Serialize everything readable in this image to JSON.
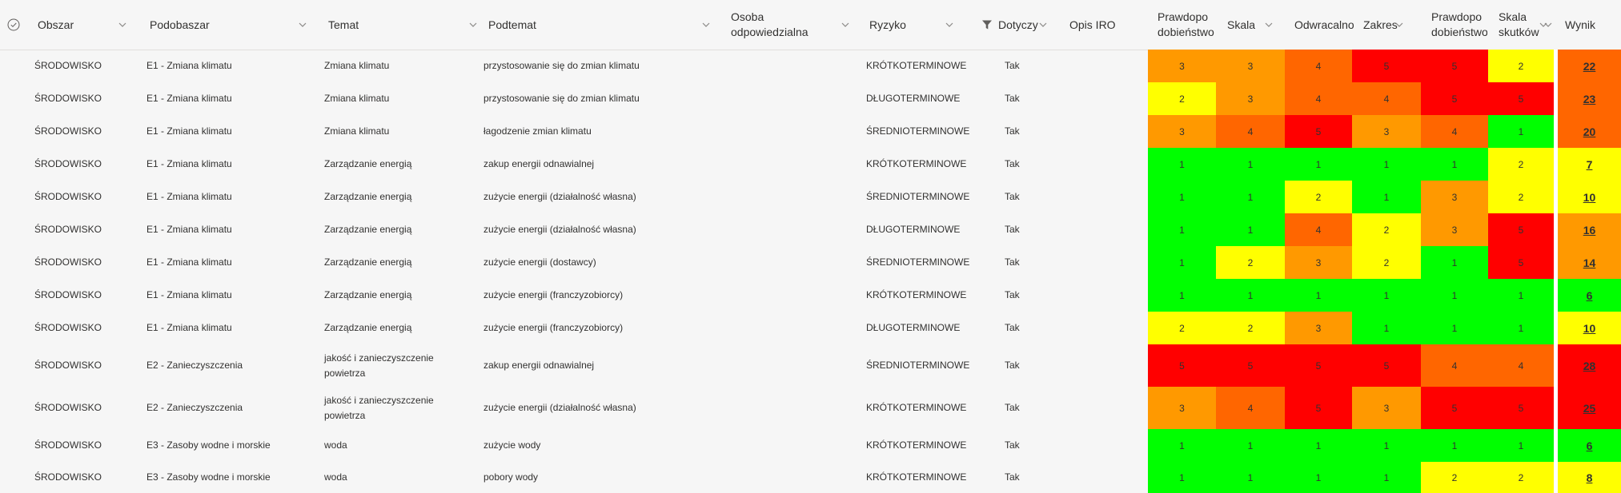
{
  "header": {
    "select_all_label": "",
    "columns": [
      {
        "key": "obszar",
        "label": "Obszar"
      },
      {
        "key": "podobszar",
        "label": "Podobaszar"
      },
      {
        "key": "temat",
        "label": "Temat"
      },
      {
        "key": "podtemat",
        "label": "Podtemat"
      },
      {
        "key": "osoba",
        "label": "Osoba odpowiedzialna"
      },
      {
        "key": "ryzyko",
        "label": "Ryzyko"
      },
      {
        "key": "dotyczy",
        "label": "Dotyczy"
      },
      {
        "key": "opis",
        "label": "Opis IRO"
      },
      {
        "key": "prawdopodobienstwo",
        "label": "Prawdopo dobieństwo"
      },
      {
        "key": "skala",
        "label": "Skala"
      },
      {
        "key": "odwracalnosc",
        "label": "Odwracalnoś"
      },
      {
        "key": "zakres",
        "label": "Zakres"
      },
      {
        "key": "prawdopodobienstwo2",
        "label": "Prawdopo dobieństwo"
      },
      {
        "key": "skala_skutkow",
        "label": "Skala skutków"
      },
      {
        "key": "wynik",
        "label": "Wynik"
      }
    ],
    "filter_icon": "filter-icon",
    "chevron_icon": "chevron-down-icon"
  },
  "colors": {
    "1": "#00ff00",
    "2": "#ffff00",
    "3": "#ff9900",
    "4": "#ff6600",
    "5": "#ff0000"
  },
  "rows": [
    {
      "obszar": "ŚRODOWISKO",
      "podobszar": "E1 - Zmiana klimatu",
      "temat": "Zmiana klimatu",
      "podtemat": "przystosowanie się do zmian klimatu",
      "osoba": "",
      "ryzyko": "KRÓTKOTERMINOWE",
      "dotyczy": "Tak",
      "opis": "",
      "scores": [
        3,
        3,
        4,
        5,
        5,
        2
      ],
      "wynik": 22,
      "wynik_level": 4
    },
    {
      "obszar": "ŚRODOWISKO",
      "podobszar": "E1 - Zmiana klimatu",
      "temat": "Zmiana klimatu",
      "podtemat": "przystosowanie się do zmian klimatu",
      "osoba": "",
      "ryzyko": "DŁUGOTERMINOWE",
      "dotyczy": "Tak",
      "opis": "",
      "scores": [
        2,
        3,
        4,
        4,
        5,
        5
      ],
      "wynik": 23,
      "wynik_level": 4
    },
    {
      "obszar": "ŚRODOWISKO",
      "podobszar": "E1 - Zmiana klimatu",
      "temat": "Zmiana klimatu",
      "podtemat": "łagodzenie zmian klimatu",
      "osoba": "",
      "ryzyko": "ŚREDNIOTERMINOWE",
      "dotyczy": "Tak",
      "opis": "",
      "scores": [
        3,
        4,
        5,
        3,
        4,
        1
      ],
      "wynik": 20,
      "wynik_level": 4
    },
    {
      "obszar": "ŚRODOWISKO",
      "podobszar": "E1 - Zmiana klimatu",
      "temat": "Zarządzanie energią",
      "podtemat": "zakup energii odnawialnej",
      "osoba": "",
      "ryzyko": "KRÓTKOTERMINOWE",
      "dotyczy": "Tak",
      "opis": "",
      "scores": [
        1,
        1,
        1,
        1,
        1,
        2
      ],
      "wynik": 7,
      "wynik_level": 2
    },
    {
      "obszar": "ŚRODOWISKO",
      "podobszar": "E1 - Zmiana klimatu",
      "temat": "Zarządzanie energią",
      "podtemat": "zużycie energii (działalność własna)",
      "osoba": "",
      "ryzyko": "ŚREDNIOTERMINOWE",
      "dotyczy": "Tak",
      "opis": "",
      "scores": [
        1,
        1,
        2,
        1,
        3,
        2
      ],
      "wynik": 10,
      "wynik_level": 2
    },
    {
      "obszar": "ŚRODOWISKO",
      "podobszar": "E1 - Zmiana klimatu",
      "temat": "Zarządzanie energią",
      "podtemat": "zużycie energii (działalność własna)",
      "osoba": "",
      "ryzyko": "DŁUGOTERMINOWE",
      "dotyczy": "Tak",
      "opis": "",
      "scores": [
        1,
        1,
        4,
        2,
        3,
        5
      ],
      "wynik": 16,
      "wynik_level": 3
    },
    {
      "obszar": "ŚRODOWISKO",
      "podobszar": "E1 - Zmiana klimatu",
      "temat": "Zarządzanie energią",
      "podtemat": "zużycie energii (dostawcy)",
      "osoba": "",
      "ryzyko": "ŚREDNIOTERMINOWE",
      "dotyczy": "Tak",
      "opis": "",
      "scores": [
        1,
        2,
        3,
        2,
        1,
        5
      ],
      "wynik": 14,
      "wynik_level": 3
    },
    {
      "obszar": "ŚRODOWISKO",
      "podobszar": "E1 - Zmiana klimatu",
      "temat": "Zarządzanie energią",
      "podtemat": "zużycie energii (franczyzobiorcy)",
      "osoba": "",
      "ryzyko": "KRÓTKOTERMINOWE",
      "dotyczy": "Tak",
      "opis": "",
      "scores": [
        1,
        1,
        1,
        1,
        1,
        1
      ],
      "wynik": 6,
      "wynik_level": 1
    },
    {
      "obszar": "ŚRODOWISKO",
      "podobszar": "E1 - Zmiana klimatu",
      "temat": "Zarządzanie energią",
      "podtemat": "zużycie energii (franczyzobiorcy)",
      "osoba": "",
      "ryzyko": "DŁUGOTERMINOWE",
      "dotyczy": "Tak",
      "opis": "",
      "scores": [
        2,
        2,
        3,
        1,
        1,
        1
      ],
      "wynik": 10,
      "wynik_level": 2
    },
    {
      "obszar": "ŚRODOWISKO",
      "podobszar": "E2 - Zanieczyszczenia",
      "temat": "jakość i zanieczyszczenie powietrza",
      "podtemat": "zakup energii odnawialnej",
      "osoba": "",
      "ryzyko": "ŚREDNIOTERMINOWE",
      "dotyczy": "Tak",
      "opis": "",
      "scores": [
        5,
        5,
        5,
        5,
        4,
        4
      ],
      "wynik": 28,
      "wynik_level": 5
    },
    {
      "obszar": "ŚRODOWISKO",
      "podobszar": "E2 - Zanieczyszczenia",
      "temat": "jakość i zanieczyszczenie powietrza",
      "podtemat": "zużycie energii (działalność własna)",
      "osoba": "",
      "ryzyko": "KRÓTKOTERMINOWE",
      "dotyczy": "Tak",
      "opis": "",
      "scores": [
        3,
        4,
        5,
        3,
        5,
        5
      ],
      "wynik": 25,
      "wynik_level": 5
    },
    {
      "obszar": "ŚRODOWISKO",
      "podobszar": "E3 - Zasoby wodne i morskie",
      "temat": "woda",
      "podtemat": "zużycie wody",
      "osoba": "",
      "ryzyko": "KRÓTKOTERMINOWE",
      "dotyczy": "Tak",
      "opis": "",
      "scores": [
        1,
        1,
        1,
        1,
        1,
        1
      ],
      "wynik": 6,
      "wynik_level": 1
    },
    {
      "obszar": "ŚRODOWISKO",
      "podobszar": "E3 - Zasoby wodne i morskie",
      "temat": "woda",
      "podtemat": "pobory wody",
      "osoba": "",
      "ryzyko": "KRÓTKOTERMINOWE",
      "dotyczy": "Tak",
      "opis": "",
      "scores": [
        1,
        1,
        1,
        1,
        2,
        2
      ],
      "wynik": 8,
      "wynik_level": 2
    }
  ]
}
